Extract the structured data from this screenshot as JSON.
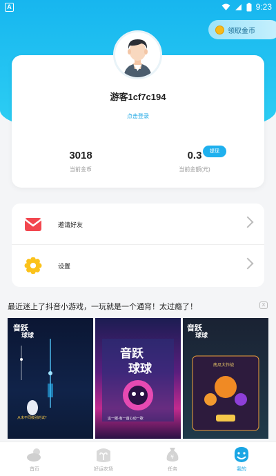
{
  "status_bar": {
    "time": "9:23",
    "app_icon": "A"
  },
  "header": {
    "coin_button_label": "领取金币"
  },
  "profile": {
    "username": "游客1cf7c194",
    "login_link": "点击登录",
    "coins_value": "3018",
    "coins_label": "当前金币",
    "balance_value": "0.3",
    "balance_label": "当前金额(元)",
    "withdraw_label": "提现"
  },
  "menu": {
    "invite_label": "邀请好友",
    "settings_label": "设置"
  },
  "ad": {
    "text": "最近迷上了抖音小游戏，一玩就是一个通宵！太过瘾了！",
    "close_label": "X"
  },
  "tabs": [
    {
      "label": "首页",
      "icon": "weather-icon",
      "active": false
    },
    {
      "label": "好运农场",
      "icon": "sprout-icon",
      "active": false
    },
    {
      "label": "任务",
      "icon": "money-bag-icon",
      "active": false
    },
    {
      "label": "我的",
      "icon": "mascot-icon",
      "active": true
    }
  ],
  "colors": {
    "accent": "#1aa6e4",
    "hero": "#17b6ef",
    "inactive": "#aaaaaa"
  }
}
